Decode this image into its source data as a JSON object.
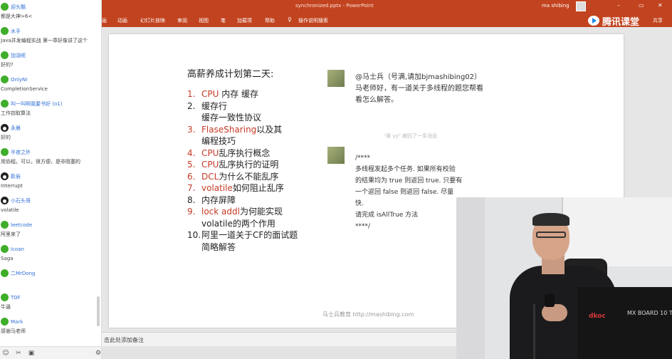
{
  "chat": {
    "messages": [
      {
        "nick": "迎头酷",
        "text": "都是大神>6<",
        "avatar": "green"
      },
      {
        "nick": "水手",
        "text": "Java并发编程实战 第一章好像讲了这个",
        "avatar": "green"
      },
      {
        "nick": "加油呢",
        "text": "好的?",
        "avatar": "green"
      },
      {
        "nick": "OnlyNI",
        "text": "CompletionService",
        "avatar": "green"
      },
      {
        "nick": "叫一叫啊我要书好 (o1)",
        "text": "工作窃取算法",
        "avatar": "green"
      },
      {
        "nick": "永晨",
        "text": "好的",
        "avatar": "penguin"
      },
      {
        "nick": "半夜之外",
        "text": "用协程。可以，很方便，是非阻塞的",
        "avatar": "green"
      },
      {
        "nick": "靳辰",
        "text": "Interrupt",
        "avatar": "penguin"
      },
      {
        "nick": "小石头哥",
        "text": "volatile",
        "avatar": "penguin"
      },
      {
        "nick": "leetcode",
        "text": "阿里来了",
        "avatar": "green"
      },
      {
        "nick": "Icoan",
        "text": "Saga",
        "avatar": "green"
      },
      {
        "nick": "二MrDong",
        "text": "",
        "avatar": "green"
      },
      {
        "nick": "TOF",
        "text": "牛逼",
        "avatar": "green"
      },
      {
        "nick": "Mark",
        "text": "感谢马老师",
        "avatar": "green"
      }
    ],
    "toolbar": {
      "emoji": "☺",
      "scissors": "✂",
      "image": "▣",
      "settings": "⚙"
    }
  },
  "window": {
    "doc_title": "synchronized.pptx  -  PowerPoint",
    "user_name": "ma shibing",
    "minimize": "–",
    "restore": "▭",
    "close": "✕"
  },
  "ribbon": {
    "tabs": [
      "画",
      "动画",
      "幻灯片放映",
      "审阅",
      "视图",
      "笔",
      "加载项",
      "帮助",
      "操作说明搜索"
    ],
    "share": "共享"
  },
  "brand": {
    "name": "腾讯课堂"
  },
  "slide": {
    "title": "高薪养成计划第二天:",
    "agenda": [
      {
        "num": "1.",
        "red": true,
        "parts": [
          {
            "t": "CPU",
            "r": true
          },
          {
            "t": " 内存 缓存",
            "r": false
          }
        ]
      },
      {
        "num": "2.",
        "red": false,
        "parts": [
          {
            "t": "缓存行",
            "r": false
          },
          {
            "t": "\n缓存一致性协议",
            "r": false
          }
        ]
      },
      {
        "num": "3.",
        "red": true,
        "parts": [
          {
            "t": "FlaseSharing",
            "r": true
          },
          {
            "t": "以及其\n编程技巧",
            "r": false
          }
        ]
      },
      {
        "num": "4.",
        "red": true,
        "parts": [
          {
            "t": "CPU",
            "r": true
          },
          {
            "t": "乱序执行概念",
            "r": false
          }
        ]
      },
      {
        "num": "5.",
        "red": true,
        "parts": [
          {
            "t": "CPU",
            "r": true
          },
          {
            "t": "乱序执行的证明",
            "r": false
          }
        ]
      },
      {
        "num": "6.",
        "red": true,
        "parts": [
          {
            "t": "DCL",
            "r": true
          },
          {
            "t": "为什么不能乱序",
            "r": false
          }
        ]
      },
      {
        "num": "7.",
        "red": true,
        "parts": [
          {
            "t": "volatile",
            "r": true
          },
          {
            "t": "如何阻止乱序",
            "r": false
          }
        ]
      },
      {
        "num": "8.",
        "red": false,
        "parts": [
          {
            "t": "内存屏障",
            "r": false
          }
        ]
      },
      {
        "num": "9.",
        "red": true,
        "parts": [
          {
            "t": "lock addl",
            "r": true
          },
          {
            "t": "为何能实现\nvolatile的两个作用",
            "r": false
          }
        ]
      },
      {
        "num": "10.",
        "red": false,
        "parts": [
          {
            "t": "阿里一道关于CF的面试题\n简略解答",
            "r": false
          }
        ]
      }
    ],
    "question1": "@马士兵（号满,请加bjmashibing02） 马老师好，有一道关于多线程的题您帮看看怎么解答。",
    "recall_note": "\"黄 yy\" 撤回了一条消息",
    "question2_lines": [
      "/****",
      "多线程发起多个任务. 如果所有校验",
      "的结果均为 true 则返回 true. 只要有",
      "一个返回 false 则返回 false. 尽量",
      "快.",
      "请完成 isAllTrue 方法",
      "****/"
    ],
    "footer": "马士兵教育 http://mashibing.com"
  },
  "notes": {
    "placeholder": "击此处添加备注"
  },
  "webcam": {
    "box_brand": "dkoc",
    "box_model": "MX BOARD 10 TKL"
  }
}
